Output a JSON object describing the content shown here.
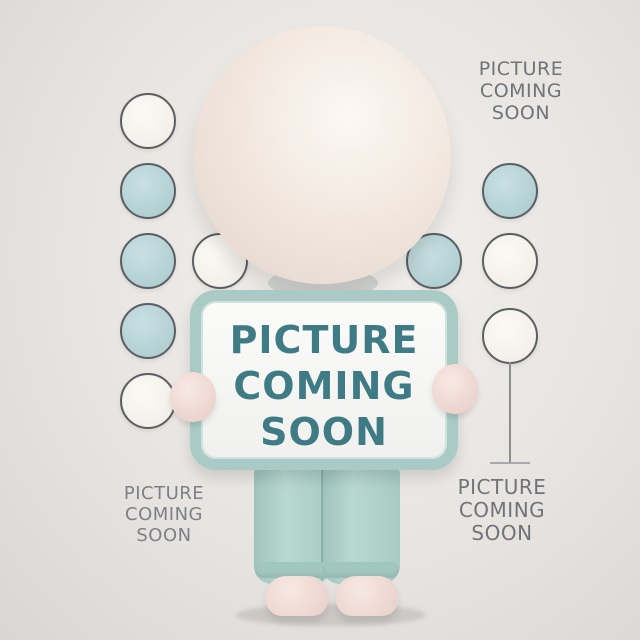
{
  "corner_label": {
    "lines": [
      "PICTURE",
      "COMING",
      "SOON"
    ]
  },
  "sign": {
    "lines": [
      "PICTURE",
      "COMING",
      "SOON"
    ]
  },
  "bottom_left_label": {
    "lines": [
      "PICTURE",
      "COMING",
      "SOON"
    ]
  },
  "bottom_right_label": {
    "lines": [
      "PICTURE",
      "COMING",
      "SOON"
    ]
  },
  "colors": {
    "background": "#e9e6e3",
    "teal": "#a9c9cc",
    "cream": "#f2efe6",
    "sign_text": "#3f7b84",
    "pants": "#a6cbc3"
  }
}
